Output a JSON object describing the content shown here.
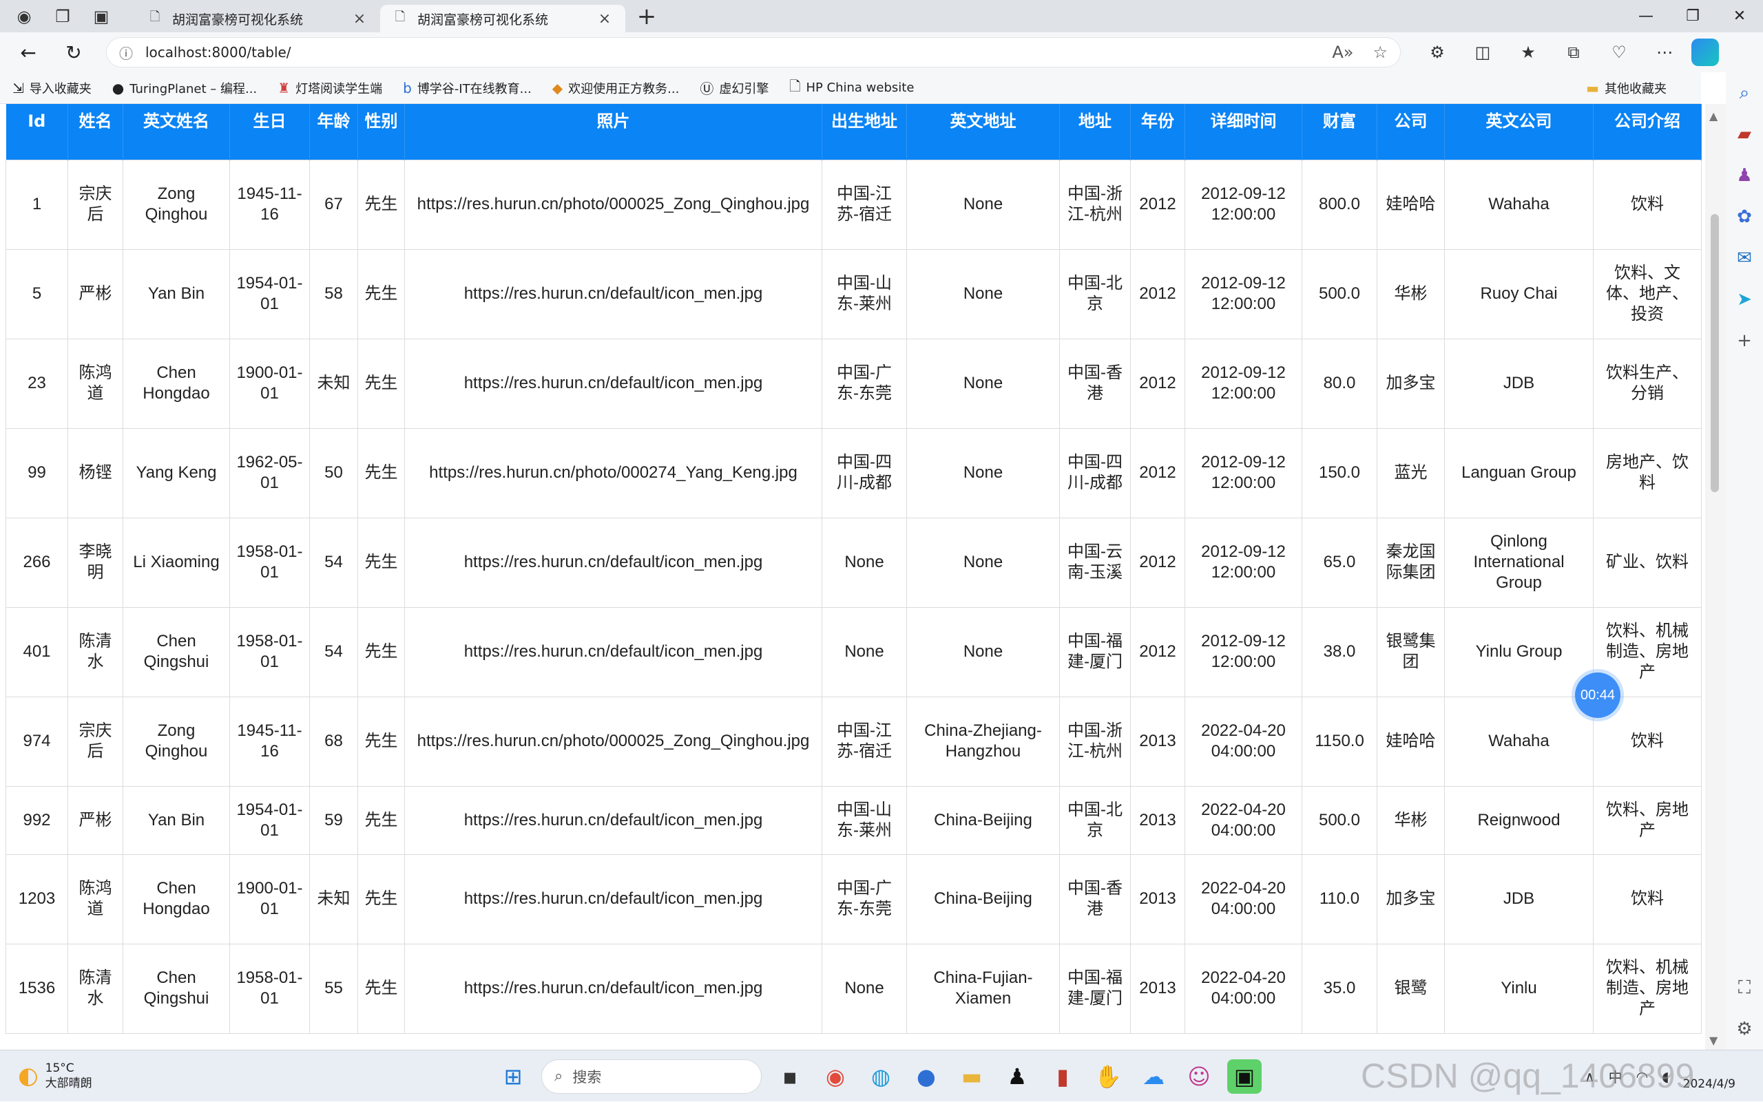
{
  "browser": {
    "tabs": [
      {
        "label": "胡润富豪榜可视化系统",
        "active": false
      },
      {
        "label": "胡润富豪榜可视化系统",
        "active": true
      }
    ],
    "url": "localhost:8000/table/",
    "bookmarks": [
      "导入收藏夹",
      "TuringPlanet – 编程...",
      "灯塔阅读学生端",
      "博学谷-IT在线教育...",
      "欢迎使用正方教务...",
      "虚幻引擎",
      "HP China website"
    ],
    "other_bookmarks": "其他收藏夹"
  },
  "table": {
    "headers": [
      "Id",
      "姓名",
      "英文姓名",
      "生日",
      "年龄",
      "性别",
      "照片",
      "出生地址",
      "英文地址",
      "地址",
      "年份",
      "详细时间",
      "财富",
      "公司",
      "英文公司",
      "公司介绍"
    ],
    "rows": [
      [
        "1",
        "宗庆后",
        "Zong Qinghou",
        "1945-11-16",
        "67",
        "先生",
        "https://res.hurun.cn/photo/000025_Zong_Qinghou.jpg",
        "中国-江苏-宿迁",
        "None",
        "中国-浙江-杭州",
        "2012",
        "2012-09-12 12:00:00",
        "800.0",
        "娃哈哈",
        "Wahaha",
        "饮料"
      ],
      [
        "5",
        "严彬",
        "Yan Bin",
        "1954-01-01",
        "58",
        "先生",
        "https://res.hurun.cn/default/icon_men.jpg",
        "中国-山东-莱州",
        "None",
        "中国-北京",
        "2012",
        "2012-09-12 12:00:00",
        "500.0",
        "华彬",
        "Ruoy Chai",
        "饮料、文体、地产、投资"
      ],
      [
        "23",
        "陈鸿道",
        "Chen Hongdao",
        "1900-01-01",
        "未知",
        "先生",
        "https://res.hurun.cn/default/icon_men.jpg",
        "中国-广东-东莞",
        "None",
        "中国-香港",
        "2012",
        "2012-09-12 12:00:00",
        "80.0",
        "加多宝",
        "JDB",
        "饮料生产、分销"
      ],
      [
        "99",
        "杨铿",
        "Yang Keng",
        "1962-05-01",
        "50",
        "先生",
        "https://res.hurun.cn/photo/000274_Yang_Keng.jpg",
        "中国-四川-成都",
        "None",
        "中国-四川-成都",
        "2012",
        "2012-09-12 12:00:00",
        "150.0",
        "蓝光",
        "Languan Group",
        "房地产、饮料"
      ],
      [
        "266",
        "李晓明",
        "Li Xiaoming",
        "1958-01-01",
        "54",
        "先生",
        "https://res.hurun.cn/default/icon_men.jpg",
        "None",
        "None",
        "中国-云南-玉溪",
        "2012",
        "2012-09-12 12:00:00",
        "65.0",
        "秦龙国际集团",
        "Qinlong International Group",
        "矿业、饮料"
      ],
      [
        "401",
        "陈清水",
        "Chen Qingshui",
        "1958-01-01",
        "54",
        "先生",
        "https://res.hurun.cn/default/icon_men.jpg",
        "None",
        "None",
        "中国-福建-厦门",
        "2012",
        "2012-09-12 12:00:00",
        "38.0",
        "银鹭集团",
        "Yinlu Group",
        "饮料、机械制造、房地产"
      ],
      [
        "974",
        "宗庆后",
        "Zong Qinghou",
        "1945-11-16",
        "68",
        "先生",
        "https://res.hurun.cn/photo/000025_Zong_Qinghou.jpg",
        "中国-江苏-宿迁",
        "China-Zhejiang-Hangzhou",
        "中国-浙江-杭州",
        "2013",
        "2022-04-20 04:00:00",
        "1150.0",
        "娃哈哈",
        "Wahaha",
        "饮料"
      ],
      [
        "992",
        "严彬",
        "Yan Bin",
        "1954-01-01",
        "59",
        "先生",
        "https://res.hurun.cn/default/icon_men.jpg",
        "中国-山东-莱州",
        "China-Beijing",
        "中国-北京",
        "2013",
        "2022-04-20 04:00:00",
        "500.0",
        "华彬",
        "Reignwood",
        "饮料、房地产"
      ],
      [
        "1203",
        "陈鸿道",
        "Chen Hongdao",
        "1900-01-01",
        "未知",
        "先生",
        "https://res.hurun.cn/default/icon_men.jpg",
        "中国-广东-东莞",
        "China-Beijing",
        "中国-香港",
        "2013",
        "2022-04-20 04:00:00",
        "110.0",
        "加多宝",
        "JDB",
        "饮料"
      ],
      [
        "1536",
        "陈清水",
        "Chen Qingshui",
        "1958-01-01",
        "55",
        "先生",
        "https://res.hurun.cn/default/icon_men.jpg",
        "None",
        "China-Fujian-Xiamen",
        "中国-福建-厦门",
        "2013",
        "2022-04-20 04:00:00",
        "35.0",
        "银鹭",
        "Yinlu",
        "饮料、机械制造、房地产"
      ]
    ]
  },
  "timer": "00:44",
  "taskbar": {
    "temperature": "15°C",
    "weather": "大部晴朗",
    "search_placeholder": "搜索",
    "date": "2024/4/9"
  },
  "watermark": "CSDN @qq_1406899"
}
